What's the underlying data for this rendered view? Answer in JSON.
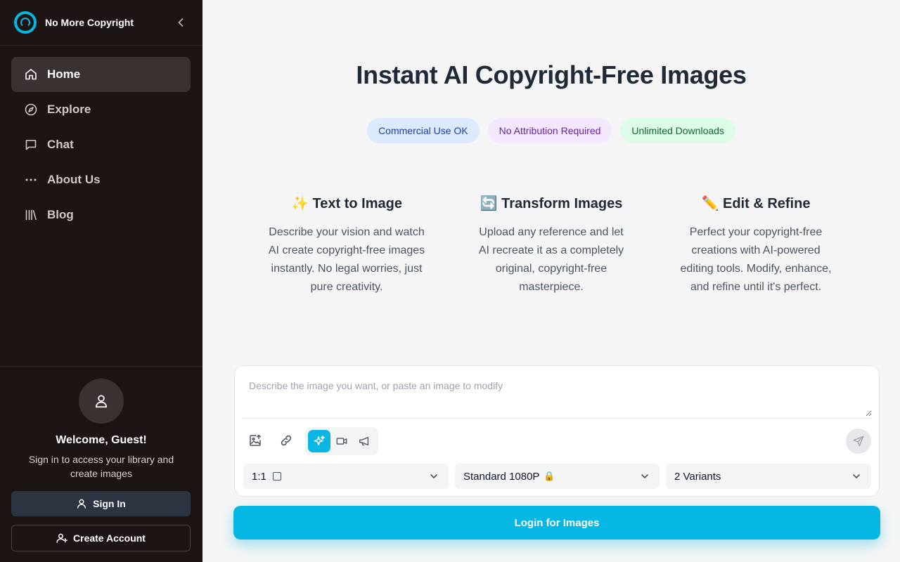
{
  "app": {
    "name": "No More Copyright"
  },
  "sidebar": {
    "items": [
      {
        "label": "Home",
        "icon": "home-icon",
        "active": true
      },
      {
        "label": "Explore",
        "icon": "compass-icon",
        "active": false
      },
      {
        "label": "Chat",
        "icon": "chat-icon",
        "active": false
      },
      {
        "label": "About Us",
        "icon": "more-dots-icon",
        "active": false
      },
      {
        "label": "Blog",
        "icon": "library-icon",
        "active": false
      }
    ],
    "welcome_title": "Welcome, Guest!",
    "welcome_subtitle": "Sign in to access your library and create images",
    "signin_label": "Sign In",
    "create_account_label": "Create Account"
  },
  "hero": {
    "title": "Instant AI Copyright-Free Images",
    "badges": [
      {
        "label": "Commercial Use OK",
        "color": "#1e40af",
        "bg": "#dbeafe"
      },
      {
        "label": "No Attribution Required",
        "color": "#6b21a8",
        "bg": "#f3e8ff"
      },
      {
        "label": "Unlimited Downloads",
        "color": "#166534",
        "bg": "#dcfce7"
      }
    ]
  },
  "features": [
    {
      "emoji": "✨",
      "title": "Text to Image",
      "description": "Describe your vision and watch AI create copyright-free images instantly. No legal worries, just pure creativity."
    },
    {
      "emoji": "🔄",
      "title": "Transform Images",
      "description": "Upload any reference and let AI recreate it as a completely original, copyright-free masterpiece."
    },
    {
      "emoji": "✏️",
      "title": "Edit & Refine",
      "description": "Perfect your copyright-free creations with AI-powered editing tools. Modify, enhance, and refine until it's perfect."
    }
  ],
  "composer": {
    "placeholder": "Describe the image you want, or paste an image to modify",
    "value": "",
    "aspect_ratio": "1:1",
    "quality": "Standard 1080P",
    "quality_lock": "🔒",
    "variants": "2 Variants",
    "active_mode": "image-generation"
  },
  "login_button_label": "Login for Images",
  "colors": {
    "accent": "#06b6e3",
    "sidebar_bg": "#1c1514",
    "page_bg": "#f5f5f5"
  }
}
